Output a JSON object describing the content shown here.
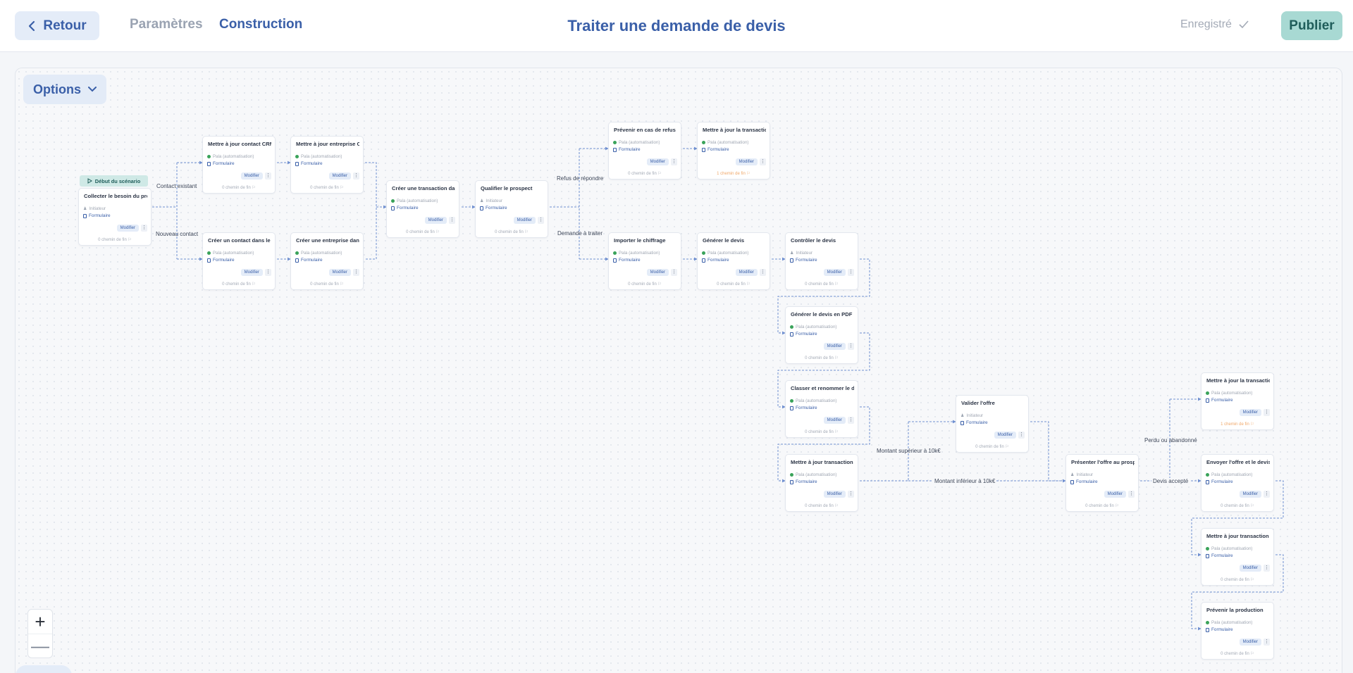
{
  "header": {
    "back_label": "Retour",
    "tab_params": "Paramètres",
    "tab_build": "Construction",
    "title": "Traiter une demande de devis",
    "saved_label": "Enregistré",
    "publish_label": "Publier"
  },
  "canvas": {
    "options_label": "Options",
    "zoom_in": "+",
    "zoom_out": "—",
    "start_badge": "Début du scénario"
  },
  "nodes": [
    {
      "title": "Collecter le besoin du prosp",
      "actor": "Initiateur",
      "form": "Formulaire",
      "modify": "Modifier",
      "end": "0 chemin de fin"
    },
    {
      "title": "Mettre à jour contact CRM",
      "actor": "Pala (automatisation)",
      "form": "Formulaire",
      "modify": "Modifier",
      "end": "0 chemin de fin"
    },
    {
      "title": "Créer un contact dans le C",
      "actor": "Pala (automatisation)",
      "form": "Formulaire",
      "modify": "Modifier",
      "end": "0 chemin de fin"
    },
    {
      "title": "Mettre à jour entreprise CR",
      "actor": "Pala (automatisation)",
      "form": "Formulaire",
      "modify": "Modifier",
      "end": "0 chemin de fin"
    },
    {
      "title": "Créer une entreprise dans l",
      "actor": "Pala (automatisation)",
      "form": "Formulaire",
      "modify": "Modifier",
      "end": "0 chemin de fin"
    },
    {
      "title": "Créer une transaction dans",
      "actor": "Pala (automatisation)",
      "form": "Formulaire",
      "modify": "Modifier",
      "end": "0 chemin de fin"
    },
    {
      "title": "Qualifier le prospect",
      "actor": "Initiateur",
      "form": "Formulaire",
      "modify": "Modifier",
      "end": "0 chemin de fin"
    },
    {
      "title": "Prévenir en cas de refus",
      "actor": "Pala (automatisation)",
      "form": "Formulaire",
      "modify": "Modifier",
      "end": "0 chemin de fin"
    },
    {
      "title": "Mettre à jour la transaction",
      "actor": "Pala (automatisation)",
      "form": "Formulaire",
      "modify": "Modifier",
      "end": "1 chemin de fin"
    },
    {
      "title": "Importer le chiffrage",
      "actor": "Pala (automatisation)",
      "form": "Formulaire",
      "modify": "Modifier",
      "end": "0 chemin de fin"
    },
    {
      "title": "Générer le devis",
      "actor": "Pala (automatisation)",
      "form": "Formulaire",
      "modify": "Modifier",
      "end": "0 chemin de fin"
    },
    {
      "title": "Contrôler le devis",
      "actor": "Initiateur",
      "form": "Formulaire",
      "modify": "Modifier",
      "end": "0 chemin de fin"
    },
    {
      "title": "Générer le devis en PDF",
      "actor": "Pala (automatisation)",
      "form": "Formulaire",
      "modify": "Modifier",
      "end": "0 chemin de fin"
    },
    {
      "title": "Classer et renommer le doc",
      "actor": "Pala (automatisation)",
      "form": "Formulaire",
      "modify": "Modifier",
      "end": "0 chemin de fin"
    },
    {
      "title": "Mettre à jour transaction d",
      "actor": "Pala (automatisation)",
      "form": "Formulaire",
      "modify": "Modifier",
      "end": "0 chemin de fin"
    },
    {
      "title": "Valider l'offre",
      "actor": "Initiateur",
      "form": "Formulaire",
      "modify": "Modifier",
      "end": "0 chemin de fin"
    },
    {
      "title": "Présenter l'offre au prospe",
      "actor": "Initiateur",
      "form": "Formulaire",
      "modify": "Modifier",
      "end": "0 chemin de fin"
    },
    {
      "title": "Mettre à jour la transaction",
      "actor": "Pala (automatisation)",
      "form": "Formulaire",
      "modify": "Modifier",
      "end": "1 chemin de fin"
    },
    {
      "title": "Envoyer l'offre et le devis a",
      "actor": "Pala (automatisation)",
      "form": "Formulaire",
      "modify": "Modifier",
      "end": "0 chemin de fin"
    },
    {
      "title": "Mettre à jour transaction d",
      "actor": "Pala (automatisation)",
      "form": "Formulaire",
      "modify": "Modifier",
      "end": "0 chemin de fin"
    },
    {
      "title": "Prévenir la production",
      "actor": "Pala (automatisation)",
      "form": "Formulaire",
      "modify": "Modifier",
      "end": "0 chemin de fin"
    }
  ],
  "edge_labels": {
    "contact_existant": "Contact existant",
    "nouveau_contact": "Nouveau contact",
    "refus": "Refus de répondre",
    "demande": "Demande à traiter",
    "montant_sup": "Montant supérieur à 10k€",
    "montant_inf": "Montant inférieur à 10k€",
    "perdu": "Perdu ou abandonné",
    "accepte": "Devis accepté"
  },
  "colors": {
    "accent": "#3a5fa8",
    "publish_bg": "#a8d9d3",
    "warn": "#f0a86a",
    "edge": "#6f8fd0"
  }
}
